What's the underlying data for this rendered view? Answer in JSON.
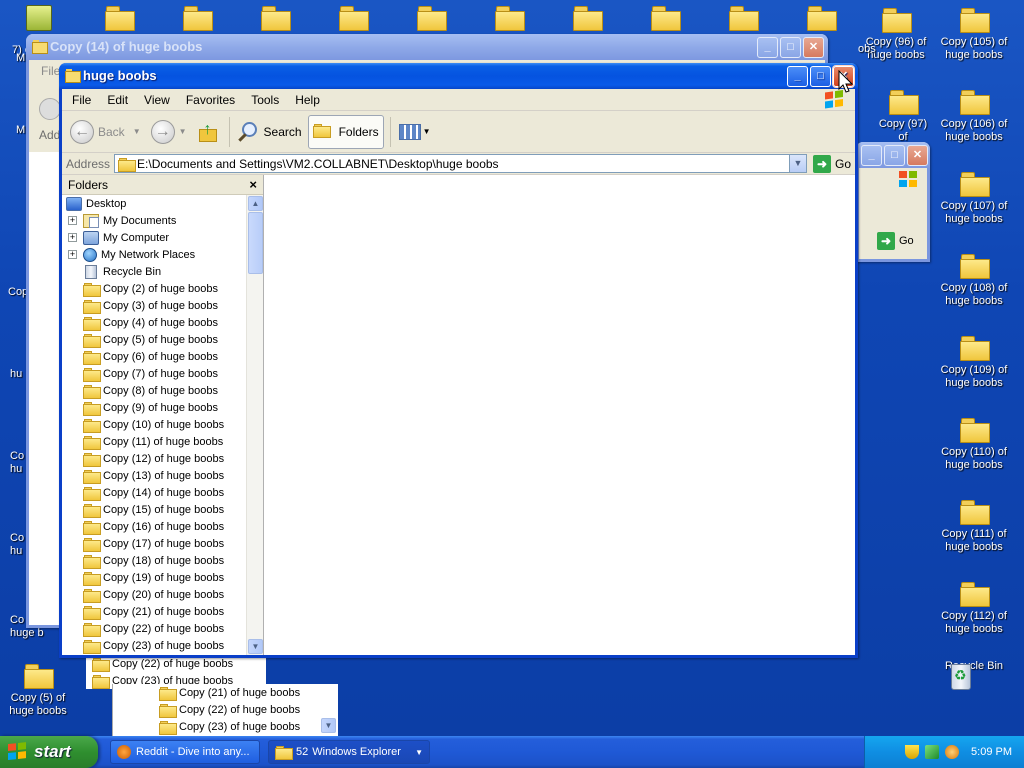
{
  "desktop": {
    "icons": [
      {
        "label": "Copy (96) of huge boobs"
      },
      {
        "label": "Copy (105) of huge boobs"
      },
      {
        "label": "Copy (97) of"
      },
      {
        "label": "Copy (106) of huge boobs"
      },
      {
        "label": "Copy (107) of huge boobs"
      },
      {
        "label": "Copy (108) of huge boobs"
      },
      {
        "label": "Copy (109) of huge boobs"
      },
      {
        "label": "Copy (110) of huge boobs"
      },
      {
        "label": "Copy (111) of huge boobs"
      },
      {
        "label": "Copy (112) of huge boobs"
      },
      {
        "label": "Recycle Bin"
      },
      {
        "label": "Copy (5) of huge boobs"
      }
    ],
    "partial_labels": [
      "7) of",
      "obs",
      "Cop",
      "hu",
      "Co",
      "hu",
      "Co",
      "hu",
      "Co",
      "huge b",
      "M",
      "M"
    ]
  },
  "back_window": {
    "title": "Copy (14) of huge boobs",
    "menu_first": "File",
    "address_label": "Addr",
    "tree_tail": [
      "Copy (22) of huge boobs",
      "Copy (23) of huge boobs"
    ]
  },
  "mid_window": {
    "title": "",
    "go_label": "Go",
    "tree_tail": [
      "Copy (21) of huge boobs",
      "Copy (22) of huge boobs",
      "Copy (23) of huge boobs"
    ]
  },
  "main_window": {
    "title": "huge boobs",
    "menu": [
      "File",
      "Edit",
      "View",
      "Favorites",
      "Tools",
      "Help"
    ],
    "toolbar": {
      "back": "Back",
      "search": "Search",
      "folders": "Folders"
    },
    "address": {
      "label": "Address",
      "value": "E:\\Documents and Settings\\VM2.COLLABNET\\Desktop\\huge boobs",
      "go": "Go"
    },
    "folders_pane": {
      "title": "Folders",
      "close": "×",
      "items": [
        {
          "label": "Desktop",
          "icon": "desktop-icon",
          "indent": 0,
          "expander": ""
        },
        {
          "label": "My Documents",
          "icon": "documents-icon",
          "indent": 1,
          "expander": "+"
        },
        {
          "label": "My Computer",
          "icon": "computer-icon",
          "indent": 1,
          "expander": "+"
        },
        {
          "label": "My Network Places",
          "icon": "network-icon",
          "indent": 1,
          "expander": "+"
        },
        {
          "label": "Recycle Bin",
          "icon": "recycle-bin-icon",
          "indent": 1,
          "expander": ""
        },
        {
          "label": "Copy (2) of huge boobs",
          "icon": "folder-icon",
          "indent": 1,
          "expander": ""
        },
        {
          "label": "Copy (3) of huge boobs",
          "icon": "folder-icon",
          "indent": 1,
          "expander": ""
        },
        {
          "label": "Copy (4) of huge boobs",
          "icon": "folder-icon",
          "indent": 1,
          "expander": ""
        },
        {
          "label": "Copy (5) of huge boobs",
          "icon": "folder-icon",
          "indent": 1,
          "expander": ""
        },
        {
          "label": "Copy (6) of huge boobs",
          "icon": "folder-icon",
          "indent": 1,
          "expander": ""
        },
        {
          "label": "Copy (7) of huge boobs",
          "icon": "folder-icon",
          "indent": 1,
          "expander": ""
        },
        {
          "label": "Copy (8) of huge boobs",
          "icon": "folder-icon",
          "indent": 1,
          "expander": ""
        },
        {
          "label": "Copy (9) of huge boobs",
          "icon": "folder-icon",
          "indent": 1,
          "expander": ""
        },
        {
          "label": "Copy (10) of huge boobs",
          "icon": "folder-icon",
          "indent": 1,
          "expander": ""
        },
        {
          "label": "Copy (11) of huge boobs",
          "icon": "folder-icon",
          "indent": 1,
          "expander": ""
        },
        {
          "label": "Copy (12) of huge boobs",
          "icon": "folder-icon",
          "indent": 1,
          "expander": ""
        },
        {
          "label": "Copy (13) of huge boobs",
          "icon": "folder-icon",
          "indent": 1,
          "expander": ""
        },
        {
          "label": "Copy (14) of huge boobs",
          "icon": "folder-icon",
          "indent": 1,
          "expander": ""
        },
        {
          "label": "Copy (15) of huge boobs",
          "icon": "folder-icon",
          "indent": 1,
          "expander": ""
        },
        {
          "label": "Copy (16) of huge boobs",
          "icon": "folder-icon",
          "indent": 1,
          "expander": ""
        },
        {
          "label": "Copy (17) of huge boobs",
          "icon": "folder-icon",
          "indent": 1,
          "expander": ""
        },
        {
          "label": "Copy (18) of huge boobs",
          "icon": "folder-icon",
          "indent": 1,
          "expander": ""
        },
        {
          "label": "Copy (19) of huge boobs",
          "icon": "folder-icon",
          "indent": 1,
          "expander": ""
        },
        {
          "label": "Copy (20) of huge boobs",
          "icon": "folder-icon",
          "indent": 1,
          "expander": ""
        },
        {
          "label": "Copy (21) of huge boobs",
          "icon": "folder-icon",
          "indent": 1,
          "expander": ""
        },
        {
          "label": "Copy (22) of huge boobs",
          "icon": "folder-icon",
          "indent": 1,
          "expander": ""
        },
        {
          "label": "Copy (23) of huge boobs",
          "icon": "folder-icon",
          "indent": 1,
          "expander": ""
        }
      ]
    }
  },
  "taskbar": {
    "start": "start",
    "tasks": [
      {
        "label": "Reddit - Dive into any...",
        "icon": "browser-icon"
      },
      {
        "count": "52",
        "label": "Windows Explorer",
        "icon": "explorer-icon"
      }
    ],
    "clock": "5:09 PM"
  },
  "colors": {
    "titlebar_active": "#0553e0",
    "desktop": "#0f46b4",
    "taskbar": "#245edb",
    "start": "#2f8f2f",
    "tray": "#0f8ee3"
  }
}
